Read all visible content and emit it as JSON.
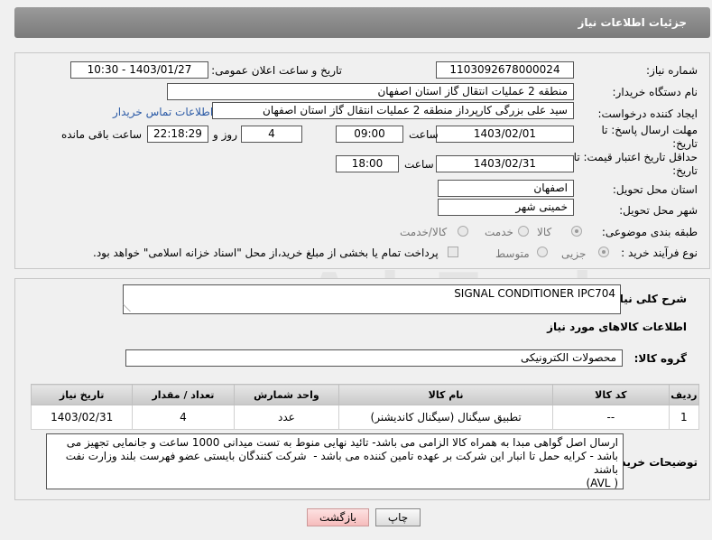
{
  "header": {
    "title": "جزئیات اطلاعات نیاز"
  },
  "watermark": "AriaTender.net",
  "fields": {
    "need_number_label": "شماره نیاز:",
    "need_number": "1103092678000024",
    "announce_label": "تاریخ و ساعت اعلان عمومی:",
    "announce_value": "1403/01/27 - 10:30",
    "buyer_label": "نام دستگاه خریدار:",
    "buyer_value": "منطقه 2 عملیات انتقال گاز استان اصفهان",
    "creator_label": "ایجاد کننده درخواست:",
    "creator_value": "سید علی بزرگی کارپرداز منطقه 2 عملیات انتقال گاز استان اصفهان",
    "contact_link": "اطلاعات تماس خریدار",
    "reply_deadline_label": "مهلت ارسال پاسخ: تا تاریخ:",
    "reply_date": "1403/02/01",
    "time_label": "ساعت",
    "reply_time": "09:00",
    "days_value": "4",
    "days_label": "روز و",
    "remaining_time": "22:18:29",
    "remaining_label": "ساعت باقی مانده",
    "price_validity_label": "حداقل تاریخ اعتبار قیمت: تا تاریخ:",
    "price_date": "1403/02/31",
    "price_time_label": "ساعت",
    "price_time": "18:00",
    "province_label": "استان محل تحویل:",
    "province_value": "اصفهان",
    "city_label": "شهر محل تحویل:",
    "city_value": "خمینی شهر",
    "category_label": "طبقه بندی موضوعی:",
    "category_options": [
      "کالا",
      "خدمت",
      "کالا/خدمت"
    ],
    "process_label": "نوع فرآیند خرید :",
    "process_options": [
      "جزیی",
      "متوسط"
    ],
    "payment_note": "پرداخت تمام یا بخشی از مبلغ خرید،از محل \"اسناد خزانه اسلامی\" خواهد بود."
  },
  "description": {
    "label": "شرح کلی نیاز:",
    "value": "SIGNAL CONDITIONER IPC704"
  },
  "goods": {
    "section_title": "اطلاعات کالاهای مورد نیاز",
    "group_label": "گروه کالا:",
    "group_value": "محصولات الکترونیکی",
    "columns": [
      "ردیف",
      "کد کالا",
      "نام کالا",
      "واحد شمارش",
      "تعداد / مقدار",
      "تاریخ نیاز"
    ],
    "rows": [
      [
        "1",
        "--",
        "تطبیق سیگنال (سیگنال کاندیشنر)",
        "عدد",
        "4",
        "1403/02/31"
      ]
    ]
  },
  "buyer_notes": {
    "label": "توضیحات خریدار:",
    "value": "ارسال اصل گواهی مبدا به همراه کالا الزامی می باشد- تائید نهایی منوط به تست میدانی 1000 ساعت و جانمایی تجهیز می باشد - کرایه حمل تا انبار این شرکت بر عهده تامین کننده می باشد -  شرکت کنندگان بایستی عضو فهرست بلند وزارت نفت باشند\n( AVL)"
  },
  "buttons": {
    "print": "چاپ",
    "back": "بازگشت"
  }
}
